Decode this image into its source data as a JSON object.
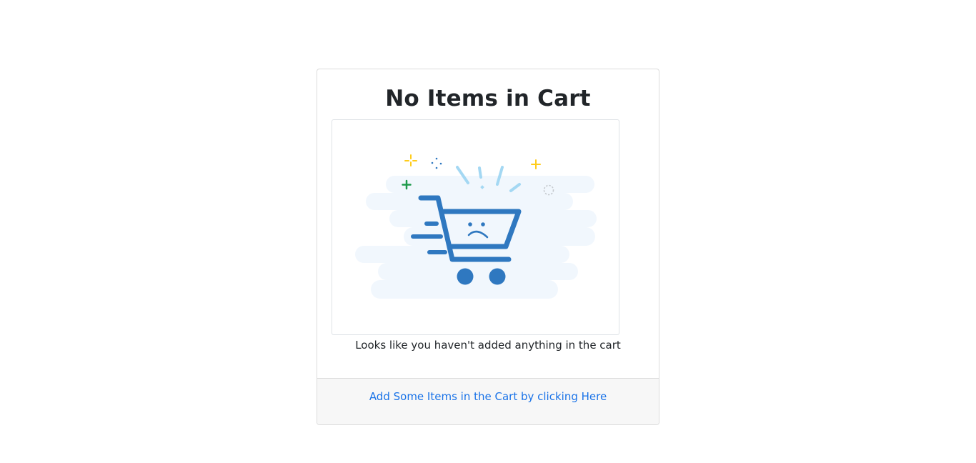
{
  "card": {
    "title": "No Items in Cart",
    "message": "Looks like you haven't added anything in the cart",
    "footer_link": "Add Some Items in the Cart by clicking Here"
  },
  "illustration": {
    "icon": "sad-shopping-cart-icon",
    "colors": {
      "cart": "#2f78c0",
      "cloud": "#f1f7fd",
      "spark_blue": "#a4d8f3",
      "spark_yellow": "#ffcc1a",
      "spark_green": "#1e9a4a",
      "spark_gray": "#c5c9ce"
    }
  },
  "colors": {
    "link": "#1a73e8",
    "text": "#212529",
    "border": "#dcdcdc",
    "footer_bg": "#f7f7f7"
  }
}
